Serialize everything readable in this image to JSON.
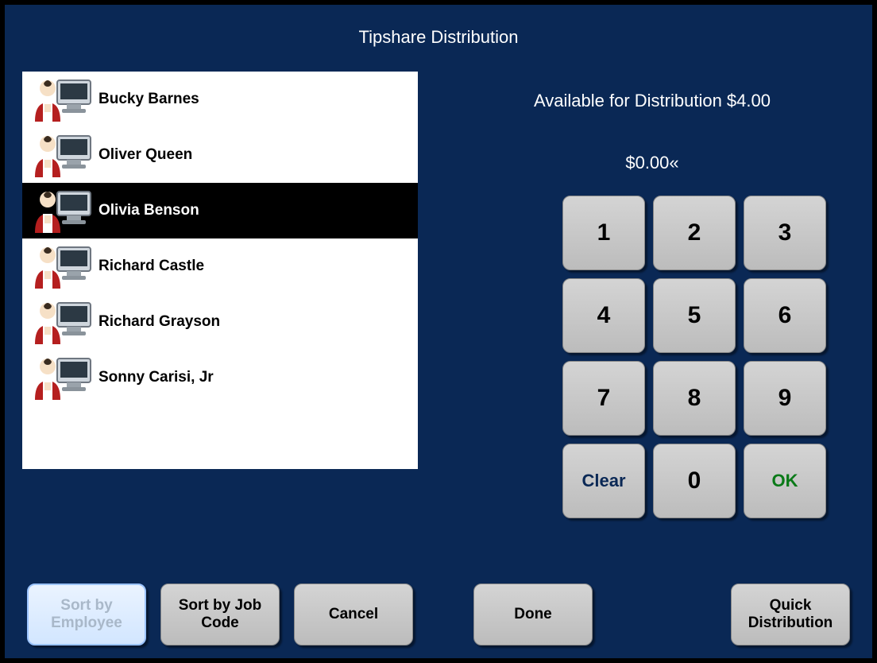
{
  "title": "Tipshare Distribution",
  "available_label": "Available for Distribution $4.00",
  "amount_display": "$0.00«",
  "employees": [
    {
      "name": "Bucky Barnes",
      "selected": false
    },
    {
      "name": "Oliver Queen",
      "selected": false
    },
    {
      "name": "Olivia Benson",
      "selected": true
    },
    {
      "name": "Richard Castle",
      "selected": false
    },
    {
      "name": "Richard Grayson",
      "selected": false
    },
    {
      "name": "Sonny Carisi, Jr",
      "selected": false
    }
  ],
  "keypad": {
    "k1": "1",
    "k2": "2",
    "k3": "3",
    "k4": "4",
    "k5": "5",
    "k6": "6",
    "k7": "7",
    "k8": "8",
    "k9": "9",
    "clear": "Clear",
    "k0": "0",
    "ok": "OK"
  },
  "buttons": {
    "sort_employee": "Sort by Employee",
    "sort_jobcode": "Sort by Job Code",
    "cancel": "Cancel",
    "done": "Done",
    "quick_dist": "Quick Distribution"
  }
}
